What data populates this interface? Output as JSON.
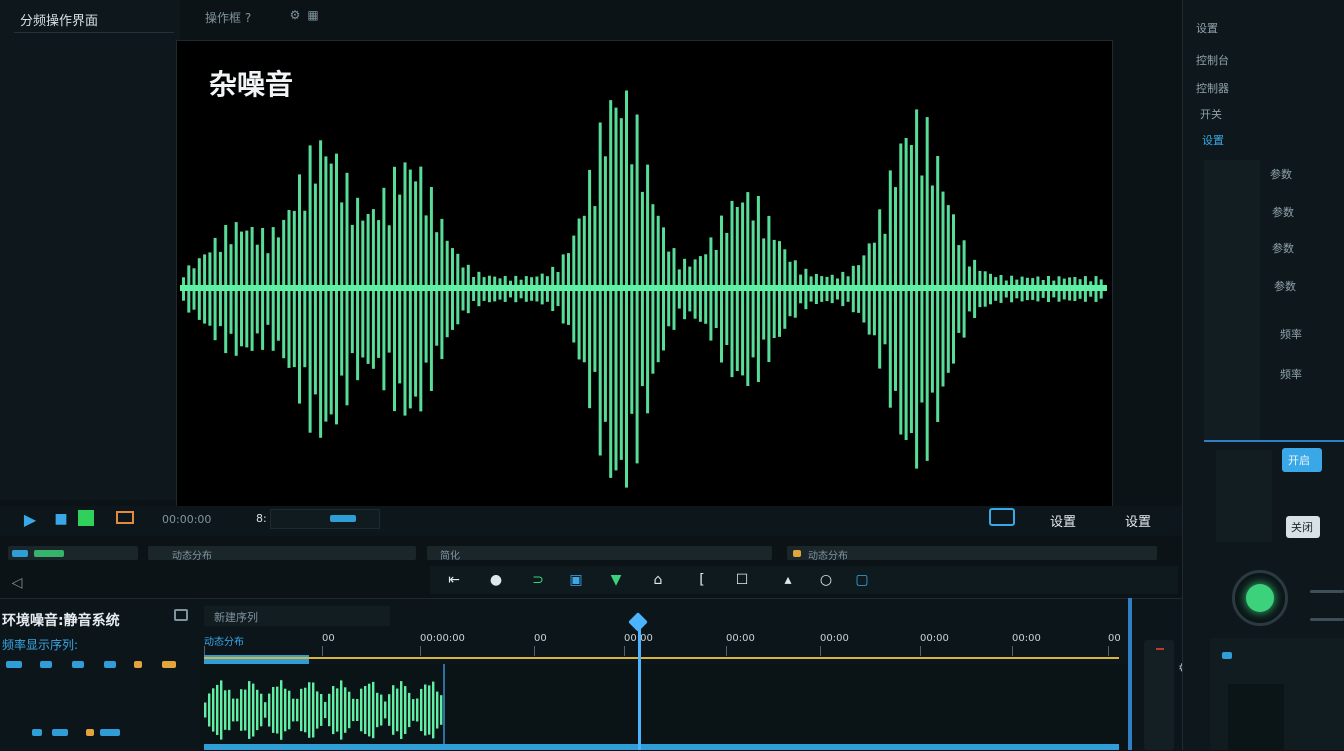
{
  "app": {
    "title": "分频操作界面"
  },
  "top_toolbar": {
    "label": "操作框 ?"
  },
  "preview": {
    "title": "杂噪音",
    "waveform_color": "#5ff0a6",
    "background": "#000000"
  },
  "transport": {
    "play_label": "播放",
    "tc1": "00:00:00",
    "tc2": "8:",
    "tc3": "设置"
  },
  "clip_bar": {
    "left": "动态分布",
    "mid": "简化",
    "right": "动态分布"
  },
  "tools": [
    "⇤",
    "●",
    "⊃",
    "▣",
    "▼",
    "⌂",
    "[",
    "☐",
    "▴",
    "○",
    "▢"
  ],
  "timeline": {
    "panel_title": "环境噪音:静音系统",
    "layers_title": "新建序列",
    "sub_label": "频率显示序列:",
    "ruler": [
      "动态分布",
      "00",
      "00:00:00",
      "00",
      "00:00",
      "00:00",
      "00:00",
      "00:00",
      "00:00",
      "00"
    ],
    "clip_color": "#5ff0a6",
    "playhead_color": "#4cb3ff"
  },
  "right_panel": {
    "items": [
      "设置",
      "控制台",
      "控制器",
      "开关",
      "设置",
      "参数",
      "参数",
      "参数",
      "参数",
      "频率",
      "频率"
    ],
    "knob_color": "#3bd27b",
    "active_button": "开启",
    "button2": "关闭"
  },
  "icons": [
    "play-icon",
    "stop-icon",
    "record-icon",
    "settings-icon",
    "knob-icon"
  ]
}
